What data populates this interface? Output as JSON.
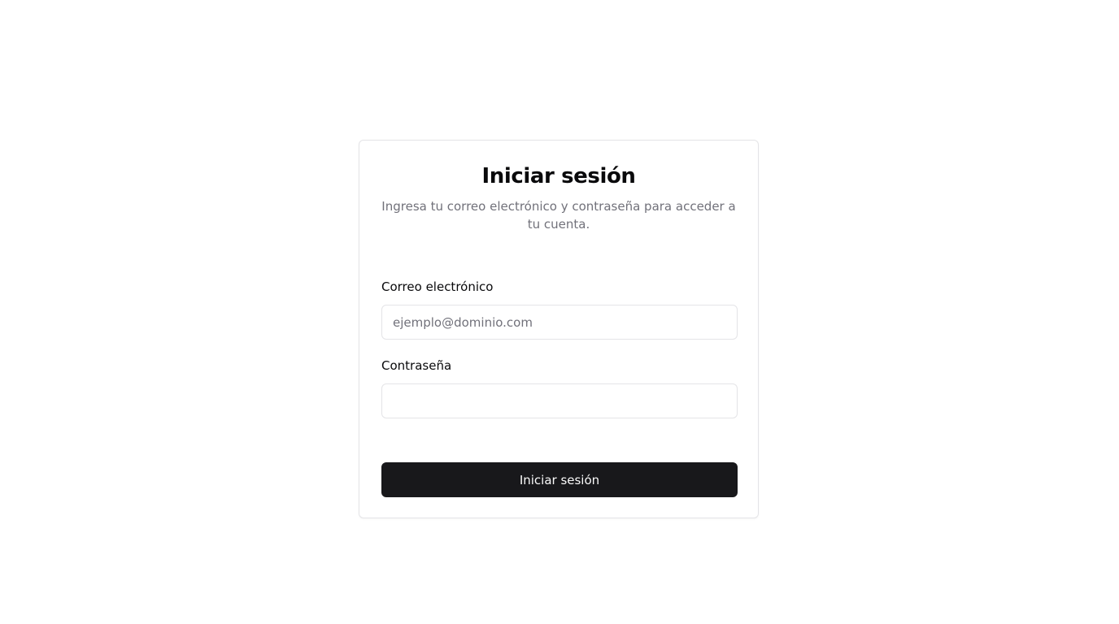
{
  "login": {
    "title": "Iniciar sesión",
    "subtitle": "Ingresa tu correo electrónico y contraseña para acceder a tu cuenta.",
    "email": {
      "label": "Correo electrónico",
      "placeholder": "ejemplo@dominio.com",
      "value": ""
    },
    "password": {
      "label": "Contraseña",
      "placeholder": "",
      "value": ""
    },
    "submit_label": "Iniciar sesión"
  },
  "colors": {
    "background": "#ffffff",
    "card_border": "#e4e4e7",
    "text_primary": "#09090b",
    "text_muted": "#71717a",
    "button_background": "#18181b",
    "button_text": "#fafafa"
  }
}
